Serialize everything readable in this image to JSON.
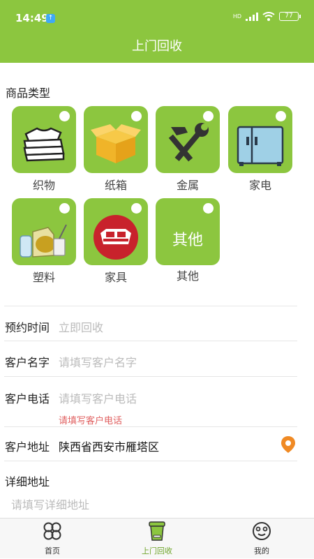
{
  "status": {
    "time": "14:49",
    "battery": "77",
    "network": "HD"
  },
  "header": {
    "title": "上门回收"
  },
  "category": {
    "title": "商品类型",
    "items": [
      {
        "label": "织物",
        "icon": "clothes-icon"
      },
      {
        "label": "纸箱",
        "icon": "box-icon"
      },
      {
        "label": "金属",
        "icon": "tools-icon"
      },
      {
        "label": "家电",
        "icon": "fridge-icon"
      },
      {
        "label": "塑料",
        "icon": "bottles-icon"
      },
      {
        "label": "家具",
        "icon": "sofa-icon"
      },
      {
        "label": "其他",
        "icon": "",
        "tile_text": "其他"
      }
    ]
  },
  "form": {
    "time_label": "预约时间",
    "time_value": "立即回收",
    "name_label": "客户名字",
    "name_placeholder": "请填写客户名字",
    "phone_label": "客户电话",
    "phone_placeholder": "请填写客户电话",
    "phone_error": "请填写客户电话",
    "address_label": "客户地址",
    "address_value": "陕西省西安市雁塔区",
    "detail_label": "详细地址",
    "detail_placeholder": "请填写详细地址"
  },
  "tabs": [
    {
      "label": "首页",
      "icon": "clover-icon",
      "active": false
    },
    {
      "label": "上门回收",
      "icon": "recycle-bin-icon",
      "active": true
    },
    {
      "label": "我的",
      "icon": "smile-icon",
      "active": false
    }
  ],
  "colors": {
    "accent": "#8cc63f",
    "error": "#e06060",
    "pin": "#f08a24"
  }
}
